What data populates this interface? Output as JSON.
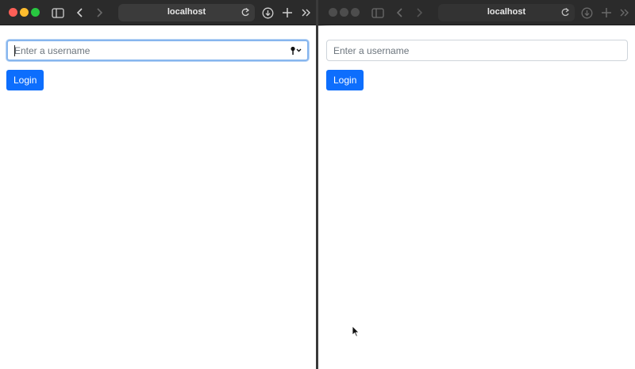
{
  "left_window": {
    "url": "localhost",
    "username_field": {
      "placeholder": "Enter a username",
      "value": ""
    },
    "login_label": "Login"
  },
  "right_window": {
    "url": "localhost",
    "username_field": {
      "placeholder": "Enter a username",
      "value": ""
    },
    "login_label": "Login"
  },
  "icons": {
    "sidebar": "sidebar-icon",
    "back": "chevron-left-icon",
    "forward": "chevron-right-icon",
    "reload": "reload-icon",
    "download": "download-icon",
    "new_tab": "plus-icon",
    "overflow": "double-chevron-icon",
    "key": "key-icon",
    "cursor": "mouse-pointer-icon"
  },
  "colors": {
    "accent": "#0d6efd",
    "focus_ring": "#87b6ee",
    "toolbar": "#2b2b2b",
    "close": "#fe5f57",
    "minimize": "#febc2e",
    "zoom": "#28c840"
  }
}
